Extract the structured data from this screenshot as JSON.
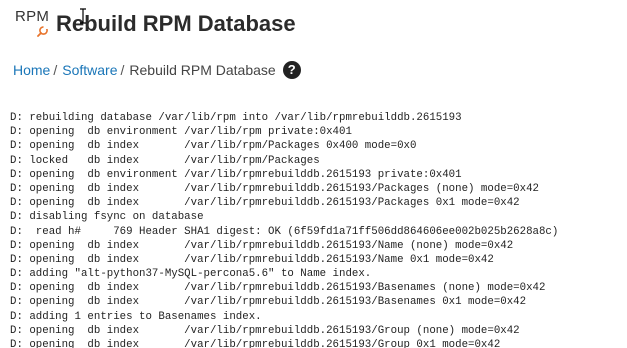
{
  "header": {
    "icon_text": "RPM",
    "icon_name": "rpm-wrench-icon",
    "title": "Rebuild RPM Database"
  },
  "breadcrumb": {
    "items": [
      {
        "label": "Home",
        "link": true
      },
      {
        "label": "Software",
        "link": true
      },
      {
        "label": "Rebuild RPM Database",
        "link": false
      }
    ],
    "separator": "/",
    "help_icon": "?"
  },
  "output": {
    "lines": [
      "D: rebuilding database /var/lib/rpm into /var/lib/rpmrebuilddb.2615193",
      "D: opening  db environment /var/lib/rpm private:0x401",
      "D: opening  db index       /var/lib/rpm/Packages 0x400 mode=0x0",
      "D: locked   db index       /var/lib/rpm/Packages",
      "D: opening  db environment /var/lib/rpmrebuilddb.2615193 private:0x401",
      "D: opening  db index       /var/lib/rpmrebuilddb.2615193/Packages (none) mode=0x42",
      "D: opening  db index       /var/lib/rpmrebuilddb.2615193/Packages 0x1 mode=0x42",
      "D: disabling fsync on database",
      "D:  read h#     769 Header SHA1 digest: OK (6f59fd1a71ff506dd864606ee002b025b2628a8c)",
      "D: opening  db index       /var/lib/rpmrebuilddb.2615193/Name (none) mode=0x42",
      "D: opening  db index       /var/lib/rpmrebuilddb.2615193/Name 0x1 mode=0x42",
      "D: adding \"alt-python37-MySQL-percona5.6\" to Name index.",
      "D: opening  db index       /var/lib/rpmrebuilddb.2615193/Basenames (none) mode=0x42",
      "D: opening  db index       /var/lib/rpmrebuilddb.2615193/Basenames 0x1 mode=0x42",
      "D: adding 1 entries to Basenames index.",
      "D: opening  db index       /var/lib/rpmrebuilddb.2615193/Group (none) mode=0x42",
      "D: opening  db index       /var/lib/rpmrebuilddb.2615193/Group 0x1 mode=0x42"
    ]
  },
  "colors": {
    "link": "#1a76b8",
    "title": "#2b2b2b",
    "icon_accent": "#e8742c"
  }
}
